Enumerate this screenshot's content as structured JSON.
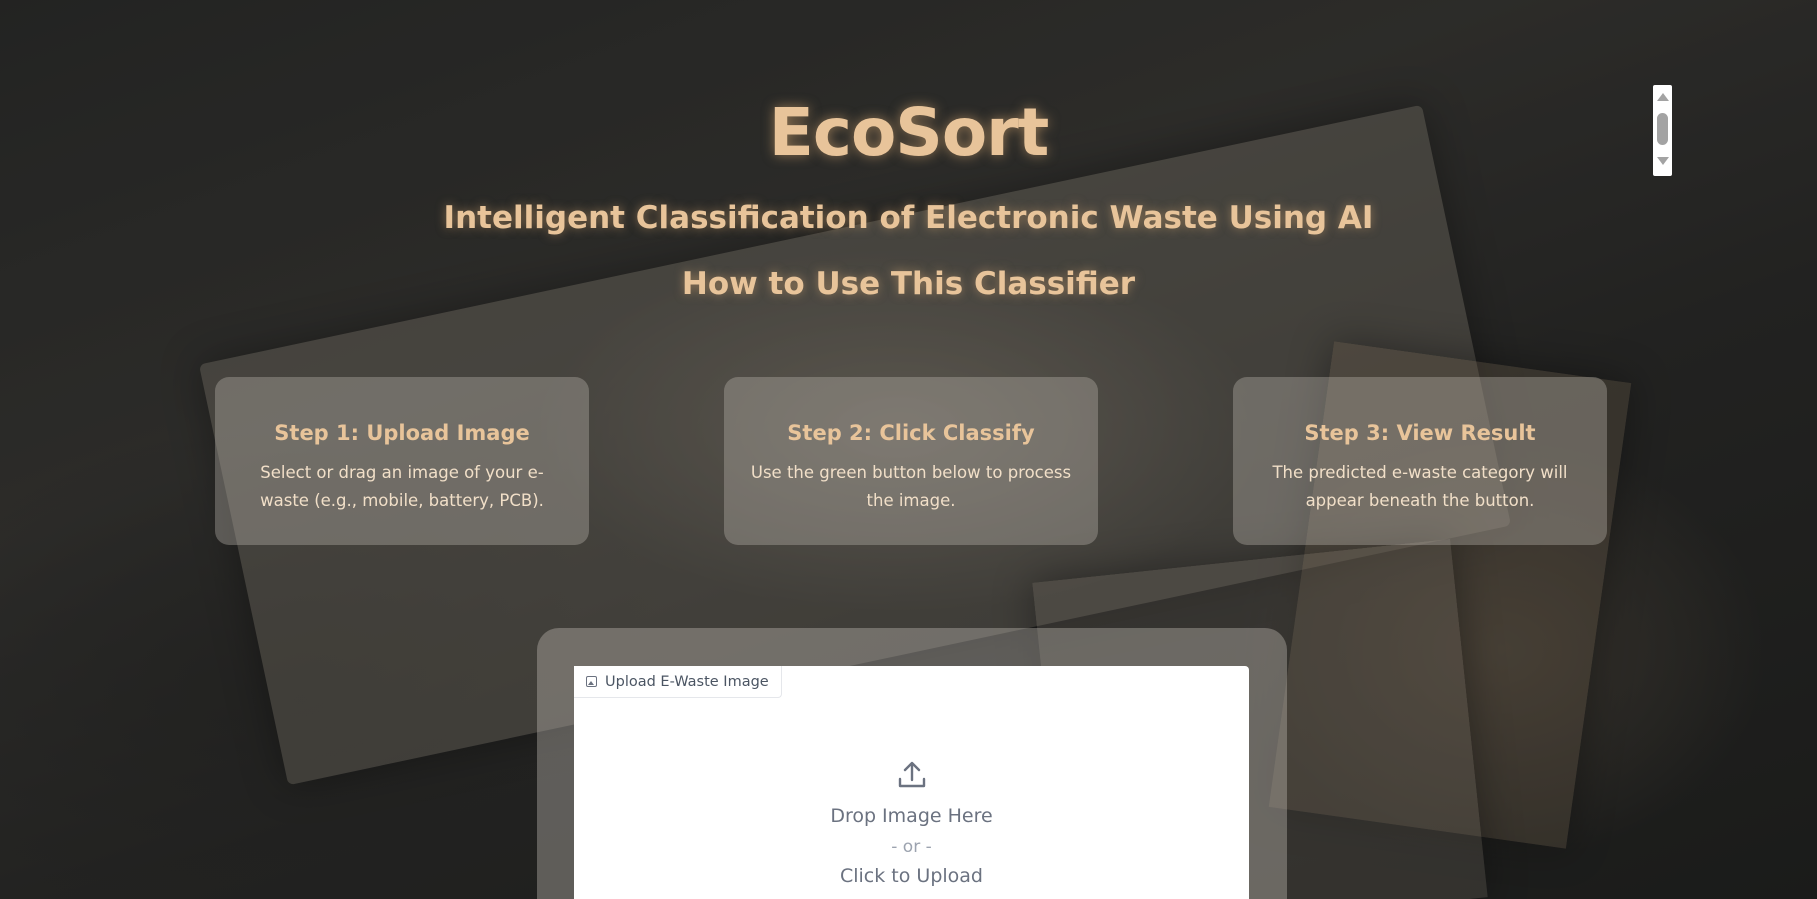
{
  "header": {
    "title": "EcoSort",
    "subtitle": "Intelligent Classification of Electronic Waste Using AI",
    "howto_heading": "How to Use This Classifier"
  },
  "steps": [
    {
      "title": "Step 1: Upload Image",
      "description": "Select or drag an image of your e-waste (e.g., mobile, battery, PCB)."
    },
    {
      "title": "Step 2: Click Classify",
      "description": "Use the green button below to process the image."
    },
    {
      "title": "Step 3: View Result",
      "description": "The predicted e-waste category will appear beneath the button."
    }
  ],
  "upload": {
    "label": "Upload E-Waste Image",
    "label_icon": "image-icon",
    "icon": "upload-icon",
    "drop_text": "Drop Image Here",
    "or_text": "- or -",
    "click_text": "Click to Upload"
  },
  "colors": {
    "accent": "#e8c49a",
    "panel_bg": "#ffffff",
    "muted_text": "#6b7280"
  }
}
